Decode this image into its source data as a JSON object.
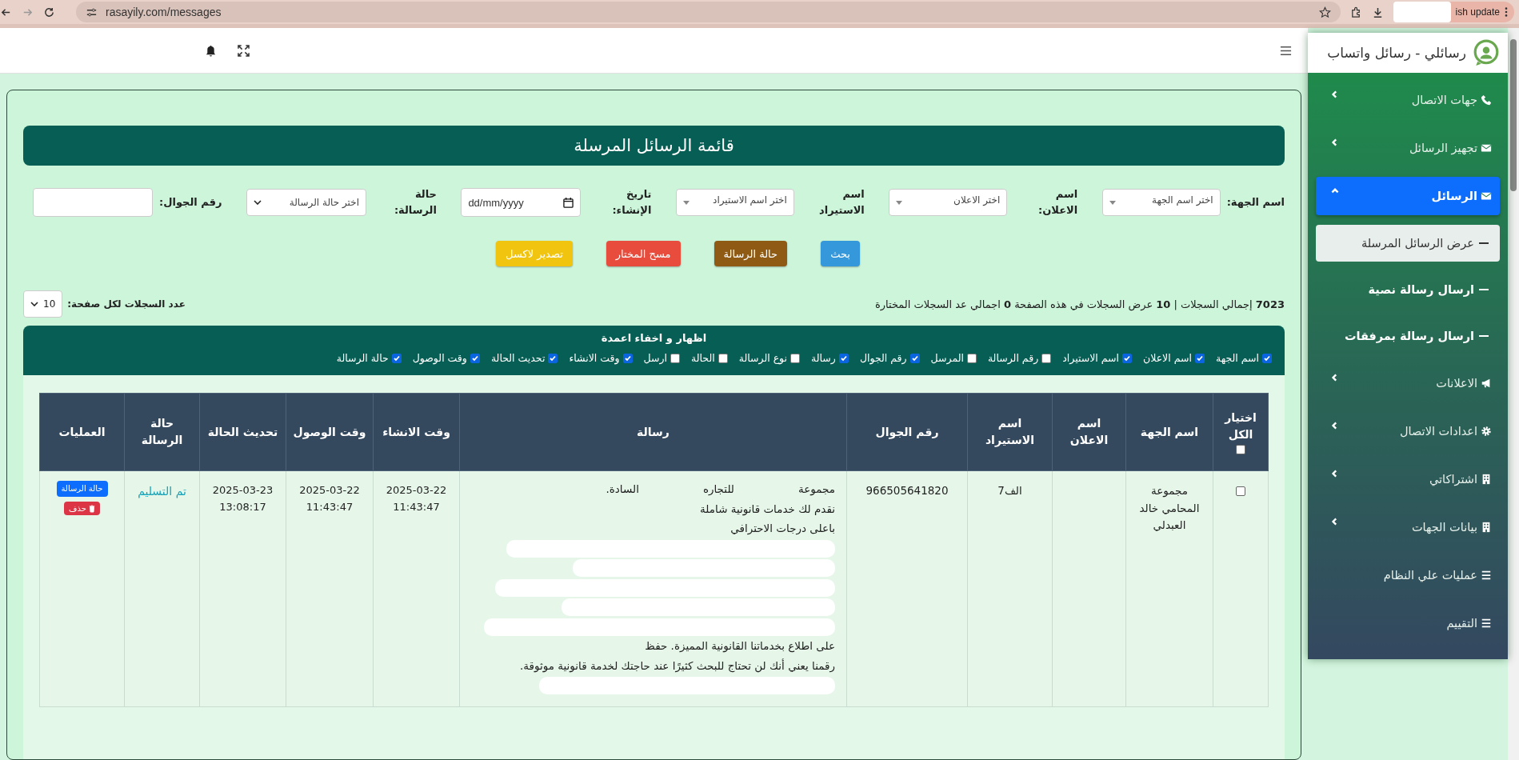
{
  "browser": {
    "url": "rasayily.com/messages",
    "update_label": "ish update"
  },
  "sidebar": {
    "title": "رسائلي - رسائل واتساب",
    "items": [
      {
        "label": "جهات الاتصال",
        "expanded": false,
        "selected": false
      },
      {
        "label": "تجهيز الرسائل",
        "expanded": false,
        "selected": false
      },
      {
        "label": "الرسائل",
        "expanded": true,
        "selected": true,
        "children": [
          {
            "label": "عرض الرسائل المرسلة",
            "selected": true
          },
          {
            "label": "ارسال رسالة نصية",
            "selected": false
          },
          {
            "label": "ارسال رسالة بمرفقات",
            "selected": false
          }
        ]
      },
      {
        "label": "الاعلانات",
        "expanded": false,
        "selected": false
      },
      {
        "label": "اعدادات الاتصال",
        "expanded": false,
        "selected": false
      },
      {
        "label": "اشتراكاتي",
        "expanded": false,
        "selected": false
      },
      {
        "label": "بيانات الجهات",
        "expanded": false,
        "selected": false
      },
      {
        "label": "عمليات علي النظام",
        "selected": false
      },
      {
        "label": "التقييم",
        "selected": false
      }
    ]
  },
  "page": {
    "title": "قائمة الرسائل المرسلة"
  },
  "filters": [
    {
      "kind": "combo",
      "label": "اسم الجهة:",
      "placeholder": "اختر اسم الجهة"
    },
    {
      "kind": "combo",
      "label": "اسم الاعلان:",
      "placeholder": "اختر الاعلان"
    },
    {
      "kind": "combo",
      "label": "اسم الاستيراد",
      "placeholder": "اختر اسم الاستيراد"
    },
    {
      "kind": "date",
      "label": "تاريخ الإنشاء:",
      "placeholder": "dd/mm/yyyy"
    },
    {
      "kind": "select",
      "label": "حالة الرسالة:",
      "placeholder": "اختر حالة الرسالة"
    },
    {
      "kind": "text",
      "label": "رقم الجوال:"
    }
  ],
  "actions": [
    {
      "label": "بحث",
      "color": "#3498db"
    },
    {
      "label": "حالة الرسالة",
      "color": "#8e5a14"
    },
    {
      "label": "مسح المختار",
      "color": "#e74c3c"
    },
    {
      "label": "تصدير لاكسل",
      "color": "#f1c40f"
    }
  ],
  "summary": {
    "text": "**7023** إجمالي السجلات | **10** عرض السجلات في هذه الصفحة **0** اجمالي عد السجلات المختارة",
    "page_size_label": "عدد السجلات لكل صفحة:",
    "page_size": "10"
  },
  "columns_panel": {
    "title": "اظهار و اخفاء اعمدة",
    "columns": [
      {
        "label": "اسم الجهة",
        "checked": true
      },
      {
        "label": "اسم الاعلان",
        "checked": true
      },
      {
        "label": "اسم الاستيراد",
        "checked": true
      },
      {
        "label": "رقم الرسالة",
        "checked": false
      },
      {
        "label": "المرسل",
        "checked": false
      },
      {
        "label": "رقم الجوال",
        "checked": true
      },
      {
        "label": "رسالة",
        "checked": true
      },
      {
        "label": "نوع الرسالة",
        "checked": false
      },
      {
        "label": "الحالة",
        "checked": false
      },
      {
        "label": "ارسل",
        "checked": false
      },
      {
        "label": "وقت الانشاء",
        "checked": true
      },
      {
        "label": "تحديث الحالة",
        "checked": true
      },
      {
        "label": "وقت الوصول",
        "checked": true
      },
      {
        "label": "حالة الرسالة",
        "checked": true
      }
    ]
  },
  "table": {
    "select_all": {
      "label": "اختيار الكل",
      "checked": false
    },
    "columns": [
      "اسم الجهة",
      "اسم الاعلان",
      "اسم الاستيراد",
      "رقم الجوال",
      "رسالة",
      "وقت الانشاء",
      "وقت الوصول",
      "تحديث الحالة",
      "حالة الرسالة",
      "العمليات"
    ],
    "rows": [
      {
        "checked": false,
        "entity": "مجموعة المحامي خالد العبدلي",
        "import_name": "الف7",
        "phone": "966505641820",
        "message": [
          {
            "kind": "text",
            "parts": [
              "مجموعة",
              "للتجاره",
              "السادة."
            ]
          },
          {
            "kind": "text",
            "parts": [
              "نقدم لك خدمات قانونية شاملة"
            ]
          },
          {
            "kind": "text",
            "parts": [
              "باعلى درجات الاحترافي"
            ]
          },
          {
            "kind": "redacted"
          },
          {
            "kind": "redacted"
          },
          {
            "kind": "redacted"
          },
          {
            "kind": "redacted"
          },
          {
            "kind": "redacted"
          },
          {
            "kind": "text",
            "parts": [
              "على اطلاع بخدماتنا القانونية المميزة. حفظ"
            ]
          },
          {
            "kind": "text",
            "parts": [
              "رقمنا يعني أنك لن تحتاج للبحث كثيرًا عند حاجتك لخدمة قانونية موثوقة."
            ]
          },
          {
            "kind": "redacted"
          }
        ],
        "created": "2025-03-22 11:43:47",
        "arrived": "2025-03-22 11:43:47",
        "updated": "2025-03-23 13:08:17",
        "status": "تم التسليم",
        "operations": [
          {
            "kind": "status",
            "label": "حالة الرسالة"
          },
          {
            "kind": "delete",
            "label": "حذف"
          }
        ]
      }
    ]
  }
}
